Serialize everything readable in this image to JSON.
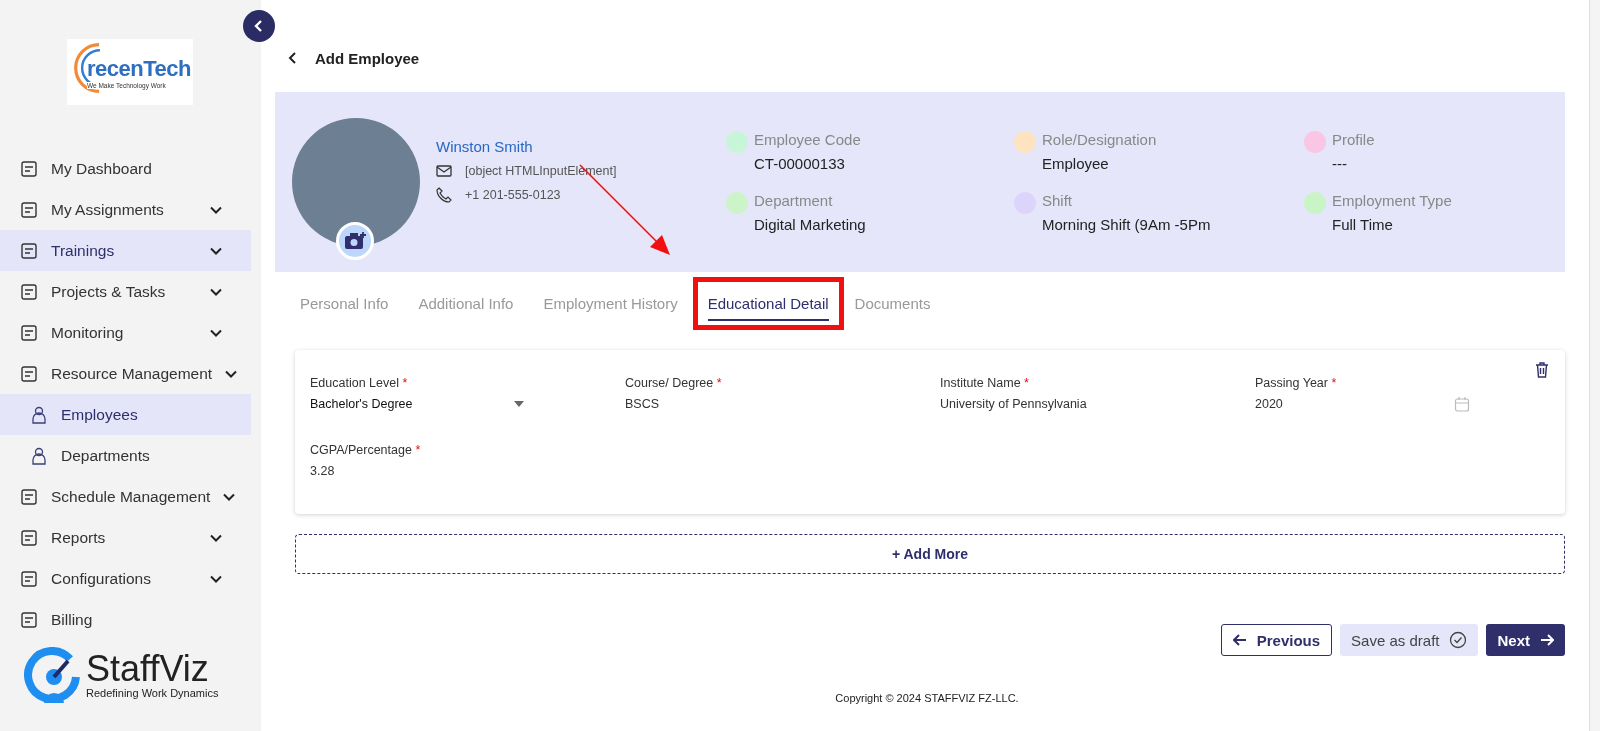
{
  "sidebar": {
    "logo": {
      "name": "recenTech",
      "tagline": "We Make Technology Work"
    },
    "items": [
      {
        "label": "My Dashboard",
        "submenu": false,
        "selected": false
      },
      {
        "label": "My Assignments",
        "submenu": true,
        "selected": false
      },
      {
        "label": "Trainings",
        "submenu": true,
        "selected": true
      },
      {
        "label": "Projects & Tasks",
        "submenu": true,
        "selected": false
      },
      {
        "label": "Monitoring",
        "submenu": true,
        "selected": false
      },
      {
        "label": "Resource Management",
        "submenu": true,
        "selected": false,
        "children": [
          {
            "label": "Employees",
            "selected": true
          },
          {
            "label": "Departments",
            "selected": false
          }
        ]
      },
      {
        "label": "Schedule Management",
        "submenu": true,
        "selected": false
      },
      {
        "label": "Reports",
        "submenu": true,
        "selected": false
      },
      {
        "label": "Configurations",
        "submenu": true,
        "selected": false
      },
      {
        "label": "Billing",
        "submenu": false,
        "selected": false
      }
    ],
    "brand": {
      "name": "StaffViz",
      "tagline": "Redefining Work Dynamics"
    }
  },
  "header": {
    "title": "Add Employee"
  },
  "profile": {
    "name": "Winston Smith",
    "email": "[object HTMLInputElement]",
    "phone": "+1 201-555-0123",
    "fields": [
      {
        "label": "Employee Code",
        "value": "CT-00000133",
        "color": "#c8f5d8"
      },
      {
        "label": "Role/Designation",
        "value": "Employee",
        "color": "#fde3c0"
      },
      {
        "label": "Profile",
        "value": "---",
        "color": "#f9c6e6"
      },
      {
        "label": "Department",
        "value": "Digital Marketing",
        "color": "#cdf3c9"
      },
      {
        "label": "Shift",
        "value": "Morning Shift (9Am -5Pm",
        "color": "#ddd4fb"
      },
      {
        "label": "Employment Type",
        "value": "Full Time",
        "color": "#c9f4c6"
      }
    ]
  },
  "tabs": [
    {
      "label": "Personal Info",
      "selected": false,
      "highlighted": false
    },
    {
      "label": "Additional Info",
      "selected": false,
      "highlighted": false
    },
    {
      "label": "Employment History",
      "selected": false,
      "highlighted": false
    },
    {
      "label": "Educational Detail",
      "selected": true,
      "highlighted": true
    },
    {
      "label": "Documents",
      "selected": false,
      "highlighted": false
    }
  ],
  "education": [
    {
      "fields": [
        {
          "label": "Education Level",
          "required_mark": "*",
          "value": "Bachelor's Degree",
          "kind": "select"
        },
        {
          "label": "Course/ Degree",
          "required_mark": "*",
          "value": "BSCS",
          "kind": "text"
        },
        {
          "label": "Institute Name",
          "required_mark": "*",
          "value": "University of Pennsylvania",
          "kind": "text"
        },
        {
          "label": "Passing Year",
          "required_mark": "*",
          "value": "2020",
          "kind": "date"
        },
        {
          "label": "CGPA/Percentage",
          "required_mark": "*",
          "value": "3.28",
          "kind": "text"
        }
      ]
    }
  ],
  "add_more": "+ Add More",
  "buttons": [
    {
      "label": "Previous",
      "kind": "back"
    },
    {
      "label": "Save as draft",
      "kind": "draft"
    },
    {
      "label": "Next",
      "kind": "next"
    }
  ],
  "footer": "Copyright © 2024 STAFFVIZ FZ-LLC."
}
